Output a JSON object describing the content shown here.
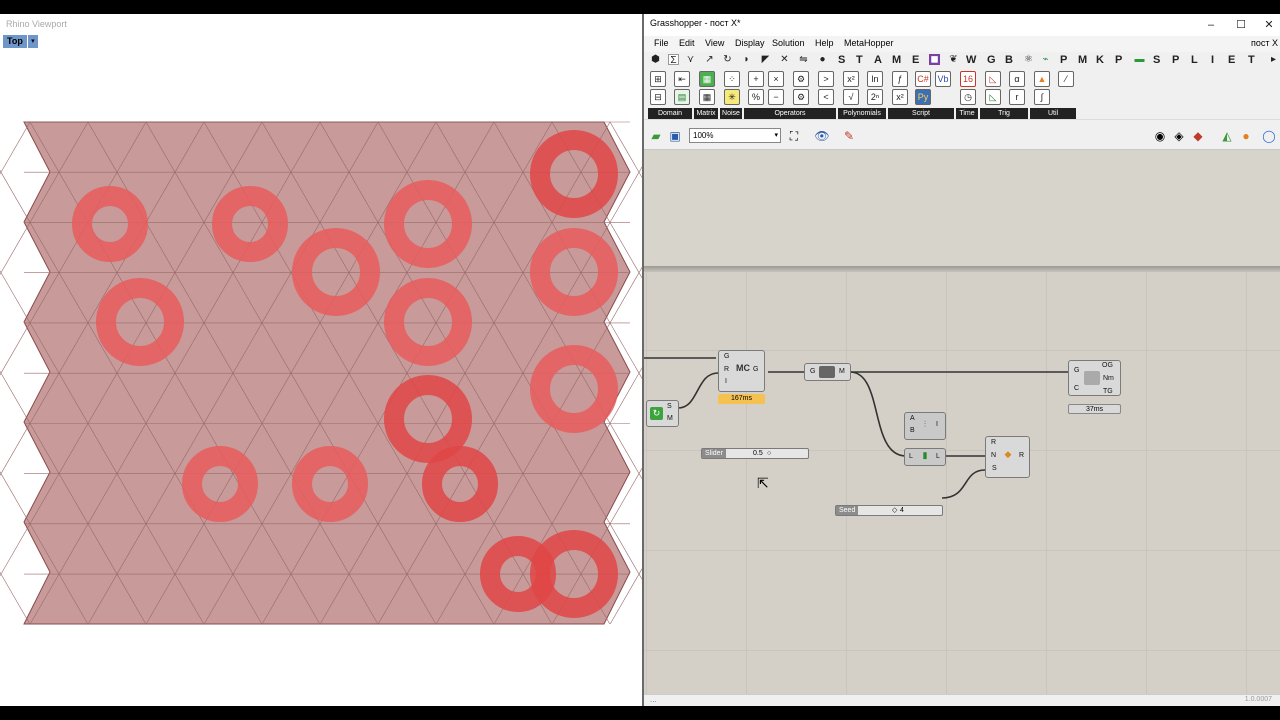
{
  "rhino": {
    "title": "Rhino Viewport",
    "view_name": "Top",
    "view_arrow": "▾"
  },
  "gh": {
    "title": "Grasshopper - пост X*",
    "window_buttons": [
      "–",
      "☐",
      "✕"
    ],
    "menu": [
      "File",
      "Edit",
      "View",
      "Display",
      "Solution",
      "Help",
      "MetaHopper"
    ],
    "menu_right": "пост X",
    "tab_letters": [
      "S",
      "T",
      "A",
      "M",
      "E",
      "W",
      "G",
      "B",
      "P",
      "M",
      "K",
      "P",
      "S",
      "P",
      "L",
      "I",
      "E",
      "T"
    ],
    "ribbon_groups": [
      "Domain",
      "Matrix",
      "Noise",
      "Operators",
      "Polynomials",
      "Script",
      "Time",
      "Trig",
      "Util"
    ],
    "zoom": "100%",
    "colors": {
      "accent_timing": "#f5c252",
      "wire": "#3a3a3a",
      "canvas": "#d4d0c8"
    },
    "components": {
      "c1": {
        "in": [
          "G",
          "R",
          "I"
        ],
        "out": "G",
        "icon_text": "MC",
        "timing": "167ms"
      },
      "c2": {
        "in": "G",
        "out": "M"
      },
      "c3": {
        "in": [
          "G",
          "C"
        ],
        "out": [
          "OG",
          "Nm",
          "TG"
        ],
        "timing": "37ms"
      },
      "c4": {
        "in": [
          "A",
          "B"
        ],
        "out": "I"
      },
      "c5": {
        "in": "L",
        "out": "L"
      },
      "c6": {
        "in": [
          "R",
          "N",
          "S"
        ],
        "out": "R"
      },
      "c7": {
        "in": [
          "S",
          "M"
        ]
      }
    },
    "sliders": [
      {
        "name": "Slider",
        "value": "0.5"
      },
      {
        "name": "Seed",
        "value": "4"
      }
    ],
    "status_left": "...",
    "version": "1.0.0007"
  }
}
